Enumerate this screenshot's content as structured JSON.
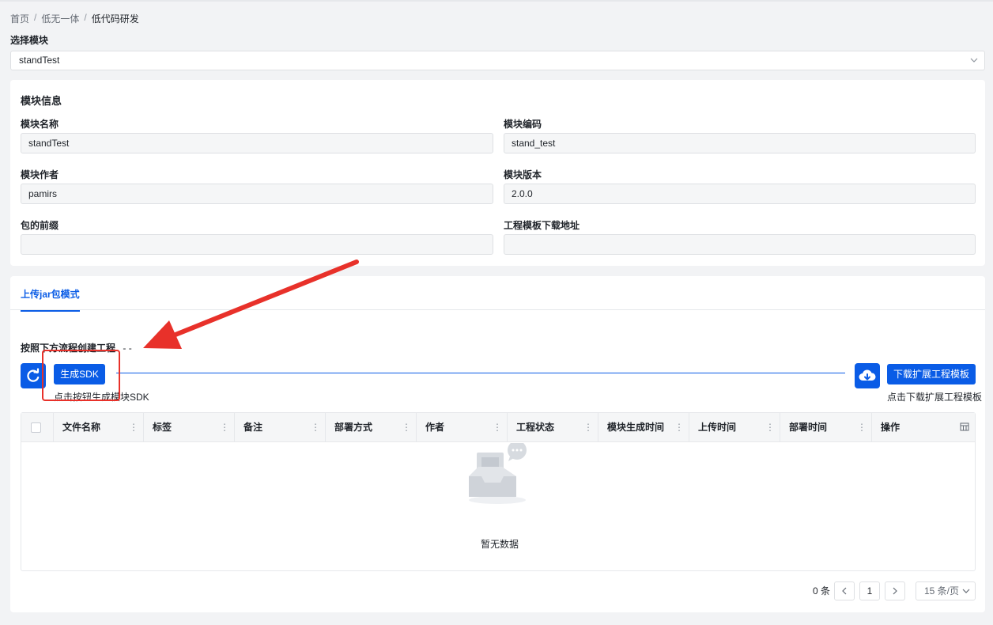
{
  "breadcrumb": {
    "items": [
      "首页",
      "低无一体",
      "低代码研发"
    ],
    "separator": "/"
  },
  "module_select": {
    "label": "选择模块",
    "value": "standTest"
  },
  "module_info": {
    "title": "模块信息",
    "fields": {
      "name": {
        "label": "模块名称",
        "value": "standTest"
      },
      "code": {
        "label": "模块编码",
        "value": "stand_test"
      },
      "author": {
        "label": "模块作者",
        "value": "pamirs"
      },
      "version": {
        "label": "模块版本",
        "value": "2.0.0"
      },
      "prefix": {
        "label": "包的前缀",
        "value": ""
      },
      "template_url": {
        "label": "工程模板下载地址",
        "value": ""
      }
    }
  },
  "upload": {
    "tab_label": "上传jar包模式",
    "flow_text": "按照下方流程创建工程",
    "flow_suffix": "- -",
    "generate_button": "生成SDK",
    "generate_hint": "点击按钮生成模块SDK",
    "download_button": "下载扩展工程模板",
    "download_hint": "点击下载扩展工程模板",
    "table": {
      "columns": [
        "文件名称",
        "标签",
        "备注",
        "部署方式",
        "作者",
        "工程状态",
        "模块生成时间",
        "上传时间",
        "部署时间",
        "操作"
      ],
      "empty_text": "暂无数据"
    },
    "pagination": {
      "total": "0 条",
      "current_page": "1",
      "page_size": "15 条/页"
    }
  },
  "colors": {
    "primary": "#0a5ce6",
    "annotation": "#e8312a"
  },
  "icons": [
    "chevron-down-icon",
    "refresh-icon",
    "cloud-download-icon",
    "column-settings-icon",
    "empty-inbox-icon"
  ]
}
